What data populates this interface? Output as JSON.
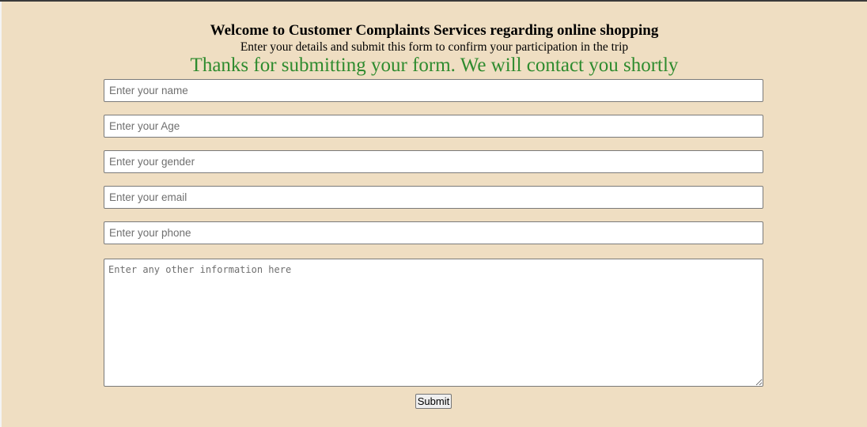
{
  "page": {
    "heading": "Welcome to Customer Complaints Services regarding online shopping",
    "subheading": "Enter your details and submit this form to confirm your participation in the trip",
    "thanks_message": "Thanks for submitting your form. We will contact you shortly"
  },
  "form": {
    "fields": [
      {
        "placeholder": "Enter your name",
        "value": ""
      },
      {
        "placeholder": "Enter your Age",
        "value": ""
      },
      {
        "placeholder": "Enter your gender",
        "value": ""
      },
      {
        "placeholder": "Enter your email",
        "value": ""
      },
      {
        "placeholder": "Enter your phone",
        "value": ""
      }
    ],
    "other_info": {
      "placeholder": "Enter any other information here",
      "value": ""
    },
    "submit_label": "Submit"
  },
  "colors": {
    "page_background": "#efdec2",
    "thanks_text": "#2e8b2e"
  }
}
